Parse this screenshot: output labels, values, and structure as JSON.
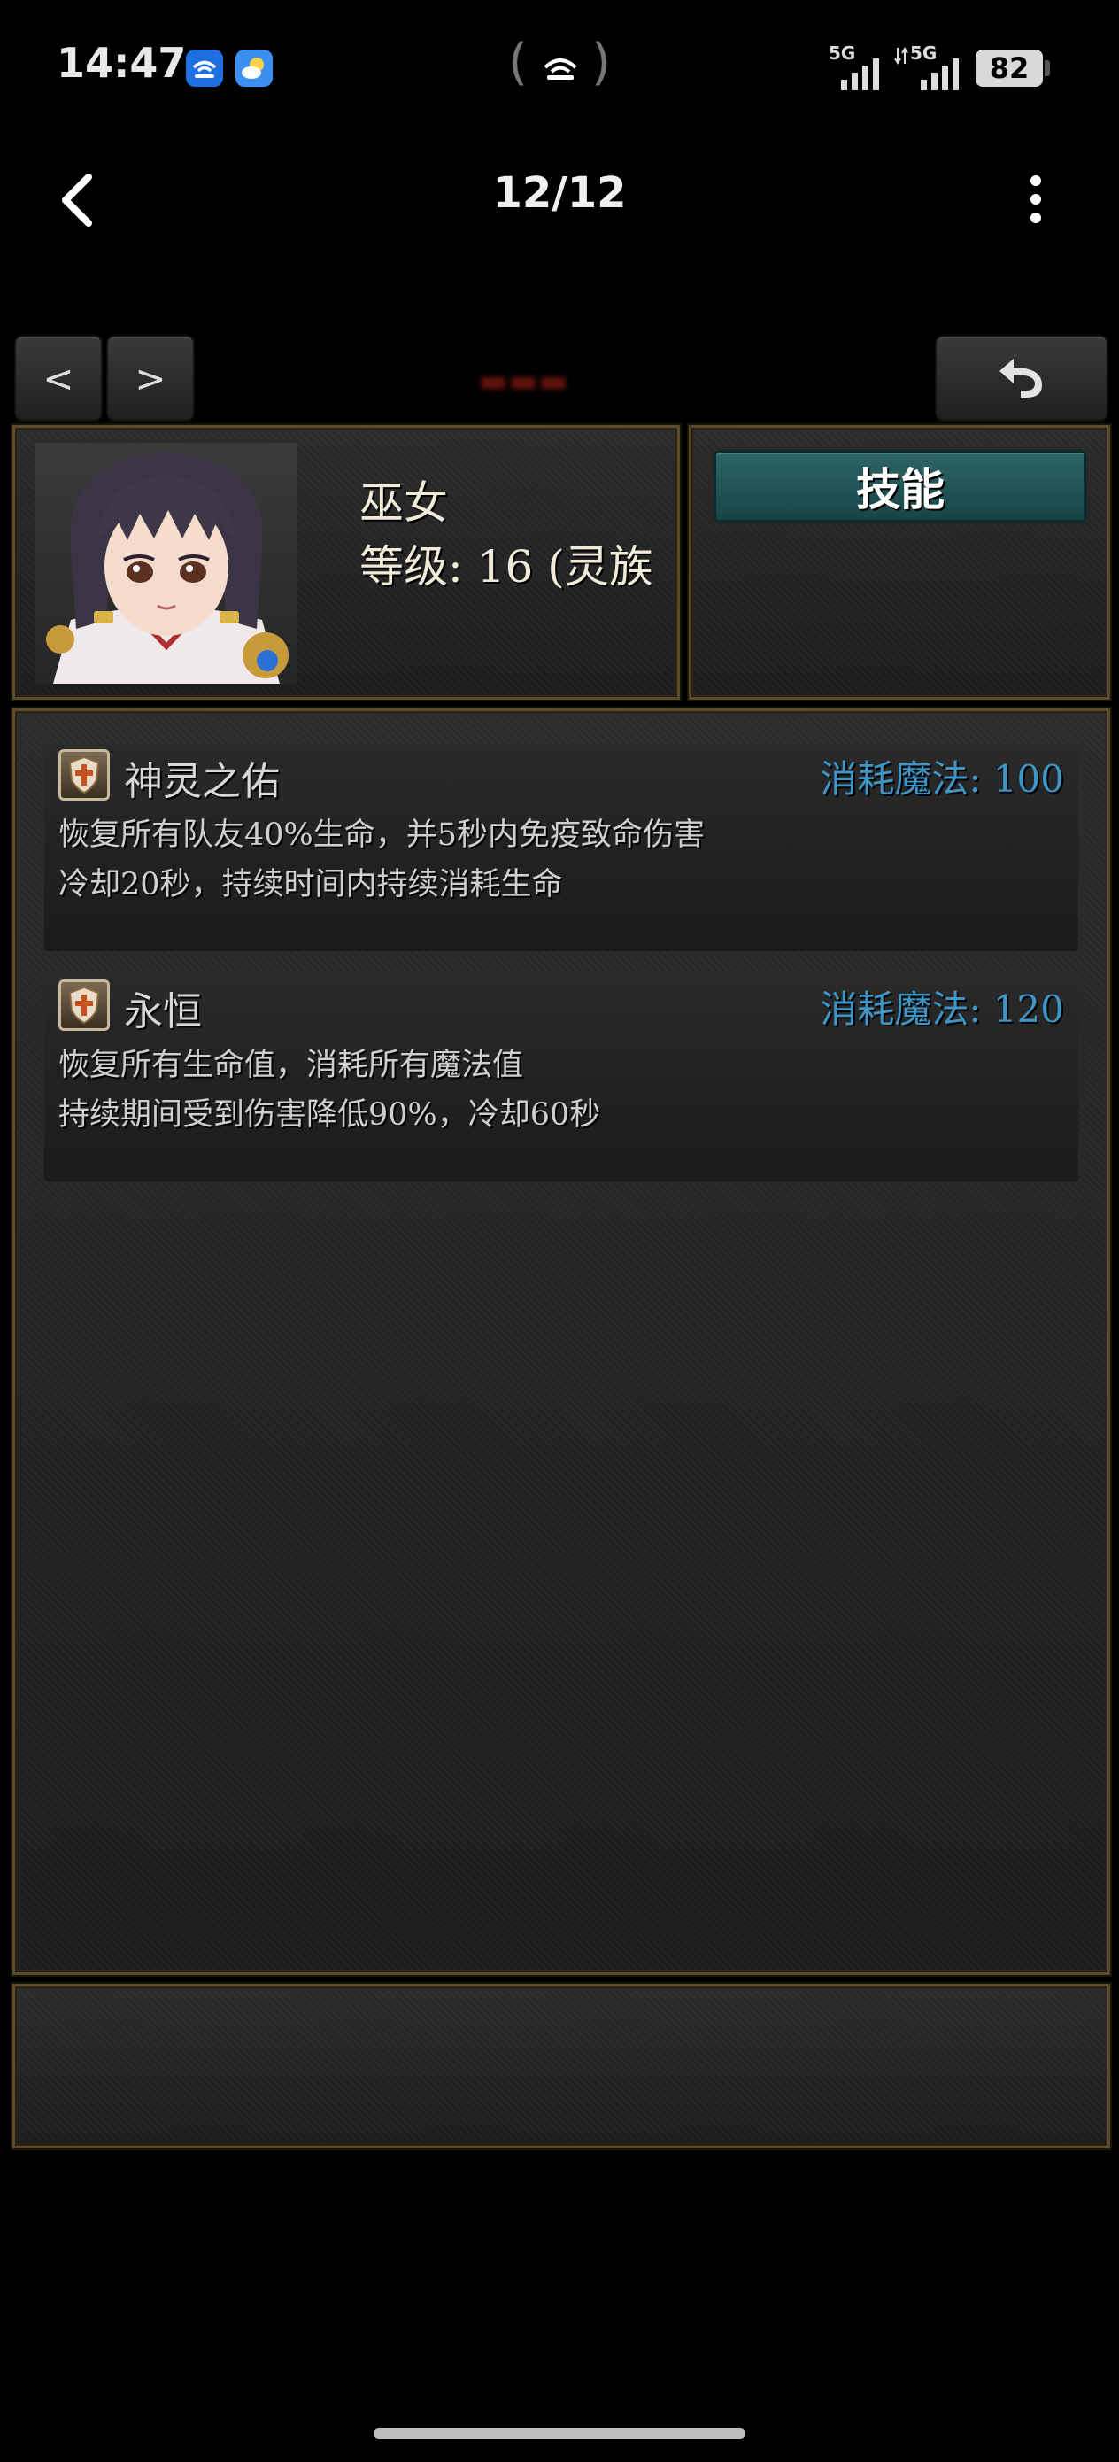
{
  "status_bar": {
    "time": "14:47",
    "battery": "82",
    "signal_1_label": "5G",
    "signal_2_label": "5G"
  },
  "nav": {
    "page_counter": "12/12"
  },
  "game": {
    "prev_label": "<",
    "next_label": ">",
    "character": {
      "name": "巫女",
      "level": "等级: 16 (灵族"
    },
    "skill_tab_label": "技能",
    "skills": [
      {
        "name": "神灵之佑",
        "cost": "消耗魔法: 100",
        "description_line_1": "恢复所有队友40%生命，并5秒内免疫致命伤害",
        "description_line_2": "冷却20秒，持续时间内持续消耗生命"
      },
      {
        "name": "永恒",
        "cost": "消耗魔法: 120",
        "description_line_1": "恢复所有生命值，消耗所有魔法值",
        "description_line_2": "持续期间受到伤害降低90%，冷却60秒"
      }
    ]
  },
  "colors": {
    "panel_border": "#5c4a2a",
    "skill_tab_bg": "#2e6566",
    "cost_text": "#3e95c6"
  },
  "icons": {
    "back": "chevron-left-icon",
    "more": "more-vertical-icon",
    "return": "undo-icon",
    "skill": "shield-cross-icon"
  }
}
